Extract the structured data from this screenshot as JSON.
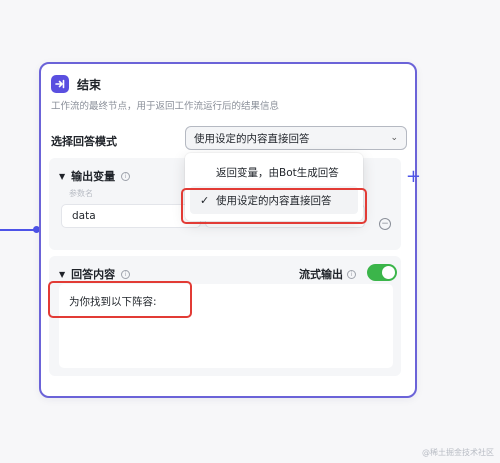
{
  "node": {
    "title": "结束",
    "description": "工作流的最终节点，用于返回工作流运行后的结果信息"
  },
  "answer_mode": {
    "label": "选择回答模式",
    "selected": "使用设定的内容直接回答",
    "options": [
      "返回变量，由Bot生成回答",
      "使用设定的内容直接回答"
    ]
  },
  "output_section": {
    "title": "输出变量",
    "param_hint": "参数名",
    "variable_name": "data",
    "add_symbol": "+",
    "remove_symbol": "−"
  },
  "answer_section": {
    "title": "回答内容",
    "stream_label": "流式输出",
    "stream_enabled": true,
    "content": "为你找到以下阵容:"
  },
  "watermark": "@稀土掘金技术社区",
  "colors": {
    "accent": "#4d53e8",
    "node_border": "#6b63d8",
    "toggle_on": "#3bb54a",
    "highlight": "#e23b35"
  },
  "icons": {
    "node": "end-node-icon",
    "select_arrow": "chevron-down-icon",
    "collapse": "triangle-down-icon",
    "info": "info-icon",
    "check": "check-icon"
  }
}
